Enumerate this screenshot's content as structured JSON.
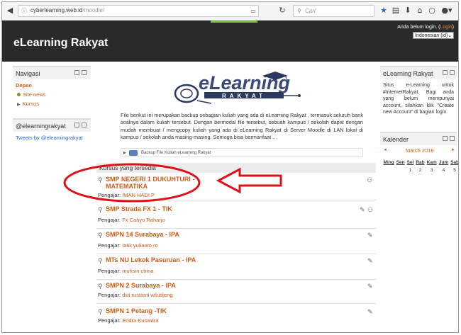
{
  "browser": {
    "url_host": "cyberlearning.web.id",
    "url_path": "/moodle/",
    "search_placeholder": "Cari"
  },
  "header": {
    "site_title": "eLearning Rakyat",
    "login_text": "Anda belum login. (",
    "login_link": "Login",
    "login_close": ")",
    "language": "Indonesian (id)"
  },
  "navigation": {
    "title": "Navigasi",
    "home": "Depan",
    "site_news": "Site news",
    "courses": "Kursus"
  },
  "twitter_block": {
    "title": "@elearningrakyat",
    "link": "Tweets by @elearningrakyat"
  },
  "intro": {
    "text": "File berikut ini merupakan backup sebagian kuliah yang ada di eLearning Rakyat , termasuk seluruh bank soalnya dalam kuliah tersebut. Dengan bermodal file tersebut, sebuah kampus / sekolah dapat dengan mudah membuat / mengcopy kuliah yang ada di eLearning Rakyat di Server Moodle di LAN lokal di kampus / sekolah anda masing-masing. Semoga bisa bermanfaat ...",
    "backup_label": "Backup File Kuliah eLearning Rakyat"
  },
  "logo": {
    "main": "eLearning",
    "sub": "RAKYAT"
  },
  "courses_header": "Kursus yang tersedia",
  "courses": [
    {
      "name": "SMP NEGERI 1 DUKUHTURI - MATEMATIKA",
      "teacher_label": "Pengajar:",
      "teacher": "IMAN HADI P"
    },
    {
      "name": "SMP Strada FX 1 - TIK",
      "teacher_label": "Pengajar:",
      "teacher": "Fx Cahyo Raharjo"
    },
    {
      "name": "SMPN 14 Surabaya - IPA",
      "teacher_label": "Pengajar:",
      "teacher": "tatik yulianto ro"
    },
    {
      "name": "MTs NU Lekok Pasuruan - IPA",
      "teacher_label": "Pengajar:",
      "teacher": "muhsin china"
    },
    {
      "name": "SMPN 2 Surabaya - IPA",
      "teacher_label": "Pengajar:",
      "teacher": "dwi rustanti wiludjeng"
    },
    {
      "name": "SMPN 1 Petang -TIK",
      "teacher_label": "Pengajar:",
      "teacher": "Endra Kuswara"
    }
  ],
  "elearning_block": {
    "title": "eLearning Rakyat",
    "text": "Situs e-Learning untuk #InternetRakyat. Bagi anda yang belum mempunyai account, silahkan klik \"Create new Account\" di bagian login."
  },
  "calendar": {
    "title": "Kalender",
    "month": "March 2016",
    "prev": "◄",
    "next": "►",
    "days": [
      "Ming",
      "Sen",
      "Sel",
      "Rab",
      "Kam",
      "Jum",
      "Sab"
    ],
    "week1": [
      "",
      "",
      "1",
      "2",
      "3",
      "4",
      "5"
    ]
  },
  "colors": {
    "accent": "#d65a14",
    "header_bg": "#2a2a2a",
    "annotation_red": "#e0101a"
  }
}
